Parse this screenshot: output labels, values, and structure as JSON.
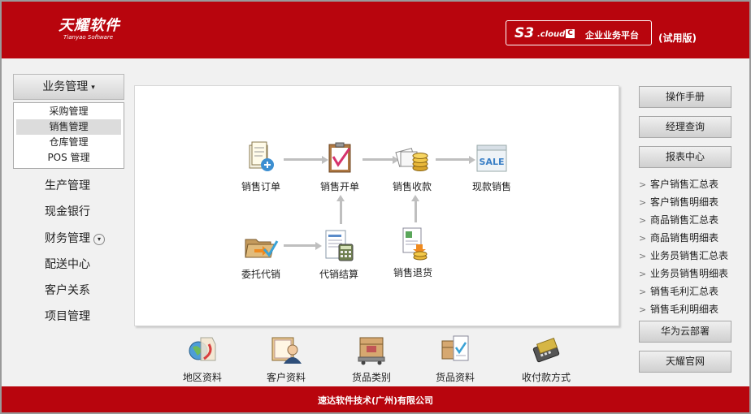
{
  "header": {
    "logo_cn": "天耀软件",
    "logo_en": "Tianyao Software",
    "brand_s3": "S3",
    "brand_cloud": ".cloud",
    "brand_c": "C",
    "brand_text": "企业业务平台",
    "trial": "(试用版)"
  },
  "sidebar": {
    "header_label": "业务管理",
    "sub_items": [
      "采购管理",
      "销售管理",
      "仓库管理",
      "POS 管理"
    ],
    "active_sub": "销售管理",
    "menu": [
      "生产管理",
      "现金银行",
      "财务管理",
      "配送中心",
      "客户关系",
      "项目管理"
    ]
  },
  "flow": {
    "nodes": [
      {
        "label": "销售订单",
        "icon": "sales-order-icon"
      },
      {
        "label": "销售开单",
        "icon": "sales-invoice-icon"
      },
      {
        "label": "销售收款",
        "icon": "sales-collection-icon"
      },
      {
        "label": "现款销售",
        "icon": "cash-sale-icon"
      },
      {
        "label": "委托代销",
        "icon": "consignment-icon"
      },
      {
        "label": "代销结算",
        "icon": "consignment-settlement-icon"
      },
      {
        "label": "销售退货",
        "icon": "sales-return-icon"
      }
    ],
    "sale_badge": "SALE"
  },
  "quick_links": [
    {
      "label": "地区资料",
      "icon": "region-icon"
    },
    {
      "label": "客户资料",
      "icon": "customer-icon"
    },
    {
      "label": "货品类别",
      "icon": "goods-category-icon"
    },
    {
      "label": "货品资料",
      "icon": "goods-info-icon"
    },
    {
      "label": "收付款方式",
      "icon": "payment-method-icon"
    }
  ],
  "right": {
    "manual": "操作手册",
    "manager": "经理查询",
    "report_center": "报表中心",
    "reports": [
      "客户销售汇总表",
      "客户销售明细表",
      "商品销售汇总表",
      "商品销售明细表",
      "业务员销售汇总表",
      "业务员销售明细表",
      "销售毛利汇总表",
      "销售毛利明细表"
    ],
    "report_bullet": ">",
    "huawei": "华为云部署",
    "official": "天耀官网"
  },
  "footer": {
    "company": "速达软件技术(广州)有限公司"
  },
  "colors": {
    "brand_red": "#b8050d",
    "panel_bg": "#f1f1f1"
  }
}
